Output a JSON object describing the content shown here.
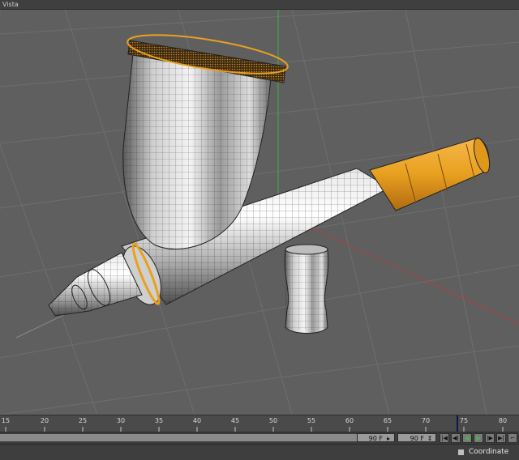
{
  "viewport": {
    "title": "Vista",
    "object_icon": "airbrush-model"
  },
  "timeline": {
    "ticks": [
      "15",
      "20",
      "25",
      "30",
      "35",
      "40",
      "45",
      "50",
      "55",
      "60",
      "65",
      "70",
      "75",
      "80"
    ],
    "current_frame": 74
  },
  "controls": {
    "max_frame_a": "90 F",
    "max_frame_b": "90 F",
    "buttons": [
      "go-to-start",
      "step-back",
      "play-backward",
      "play-forward",
      "step-forward",
      "go-to-end",
      "record"
    ]
  },
  "status": {
    "coordinate_label": "Coordinate"
  },
  "colors": {
    "viewport_bg": "#5f5f5f",
    "grid_line": "#6e6e6e",
    "chrome": "#c8c8c8",
    "orange": "#e8a020",
    "wire": "#1a1a1a",
    "axis_green": "#3ab04a",
    "axis_red": "#b04040"
  }
}
